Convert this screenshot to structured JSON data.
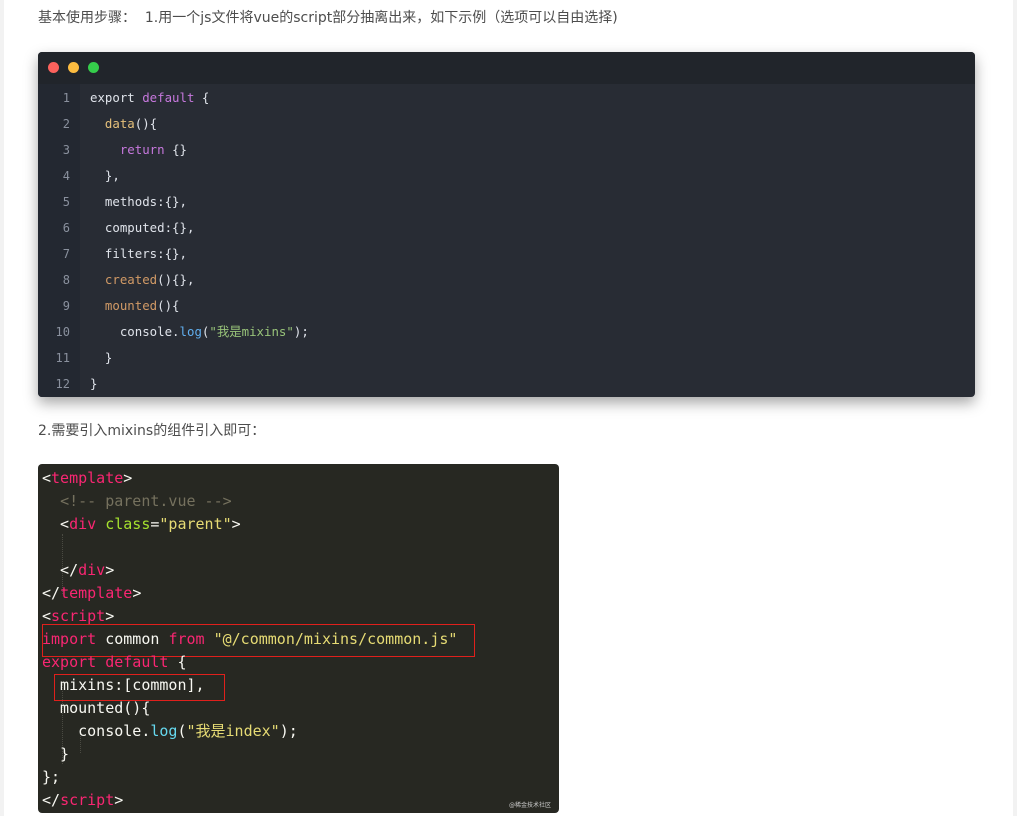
{
  "paragraphs": {
    "step1": "基本使用步骤：  1.用一个js文件将vue的script部分抽离出来，如下示例（选项可以自由选择)",
    "step2": "2.需要引入mixins的组件引入即可："
  },
  "code_block_1": {
    "theme": "one-dark",
    "window_controls": [
      "close-dot",
      "minimize-dot",
      "maximize-dot"
    ],
    "lines": [
      {
        "n": "1",
        "parts": [
          [
            "p",
            "export "
          ],
          [
            "k",
            "default"
          ],
          [
            "p",
            " {"
          ]
        ]
      },
      {
        "n": "2",
        "parts": [
          [
            "p",
            "  "
          ],
          [
            "f",
            "data"
          ],
          [
            "p",
            "(){"
          ]
        ]
      },
      {
        "n": "3",
        "parts": [
          [
            "p",
            "    "
          ],
          [
            "k",
            "return"
          ],
          [
            "p",
            " {}"
          ]
        ]
      },
      {
        "n": "4",
        "parts": [
          [
            "p",
            "  },"
          ]
        ]
      },
      {
        "n": "5",
        "parts": [
          [
            "p",
            "  methods:{},"
          ]
        ]
      },
      {
        "n": "6",
        "parts": [
          [
            "p",
            "  computed:{},"
          ]
        ]
      },
      {
        "n": "7",
        "parts": [
          [
            "p",
            "  filters:{},"
          ]
        ]
      },
      {
        "n": "8",
        "parts": [
          [
            "p",
            "  "
          ],
          [
            "o",
            "created"
          ],
          [
            "p",
            "(){},"
          ]
        ]
      },
      {
        "n": "9",
        "parts": [
          [
            "p",
            "  "
          ],
          [
            "o",
            "mounted"
          ],
          [
            "p",
            "(){"
          ]
        ]
      },
      {
        "n": "10",
        "parts": [
          [
            "p",
            "    console."
          ],
          [
            "m",
            "log"
          ],
          [
            "p",
            "("
          ],
          [
            "s",
            "\"我是mixins\""
          ],
          [
            "p",
            ");"
          ]
        ]
      },
      {
        "n": "11",
        "parts": [
          [
            "p",
            "  }"
          ]
        ]
      },
      {
        "n": "12",
        "parts": [
          [
            "p",
            "}"
          ]
        ]
      }
    ]
  },
  "code_block_2": {
    "theme": "monokai",
    "watermark": "@稀金技术社区",
    "lines": [
      [
        [
          "p",
          "<"
        ],
        [
          "t",
          "template"
        ],
        [
          "p",
          ">"
        ]
      ],
      [
        [
          "p",
          "  "
        ],
        [
          "c",
          "<!-- parent.vue -->"
        ]
      ],
      [
        [
          "p",
          "  <"
        ],
        [
          "t",
          "div"
        ],
        [
          "p",
          " "
        ],
        [
          "a",
          "class"
        ],
        [
          "p",
          "="
        ],
        [
          "s",
          "\"parent\""
        ],
        [
          "p",
          ">"
        ]
      ],
      [
        [
          "p",
          ""
        ]
      ],
      [
        [
          "p",
          "  </"
        ],
        [
          "t",
          "div"
        ],
        [
          "p",
          ">"
        ]
      ],
      [
        [
          "p",
          "</"
        ],
        [
          "t",
          "template"
        ],
        [
          "p",
          ">"
        ]
      ],
      [
        [
          "p",
          "<"
        ],
        [
          "t",
          "script"
        ],
        [
          "p",
          ">"
        ]
      ],
      [
        [
          "t",
          "import"
        ],
        [
          "p",
          " common "
        ],
        [
          "t",
          "from"
        ],
        [
          "p",
          " "
        ],
        [
          "s",
          "\"@/common/mixins/common.js\""
        ]
      ],
      [
        [
          "t",
          "export default"
        ],
        [
          "p",
          " {"
        ]
      ],
      [
        [
          "p",
          "  mixins:[common],"
        ]
      ],
      [
        [
          "p",
          "  mounted(){"
        ]
      ],
      [
        [
          "p",
          "    console."
        ],
        [
          "b",
          "log"
        ],
        [
          "p",
          "("
        ],
        [
          "s",
          "\"我是index\""
        ],
        [
          "p",
          ");"
        ]
      ],
      [
        [
          "p",
          "  }"
        ]
      ],
      [
        [
          "p",
          "};"
        ]
      ],
      [
        [
          "p",
          "</"
        ],
        [
          "t",
          "script"
        ],
        [
          "p",
          ">"
        ]
      ]
    ]
  }
}
